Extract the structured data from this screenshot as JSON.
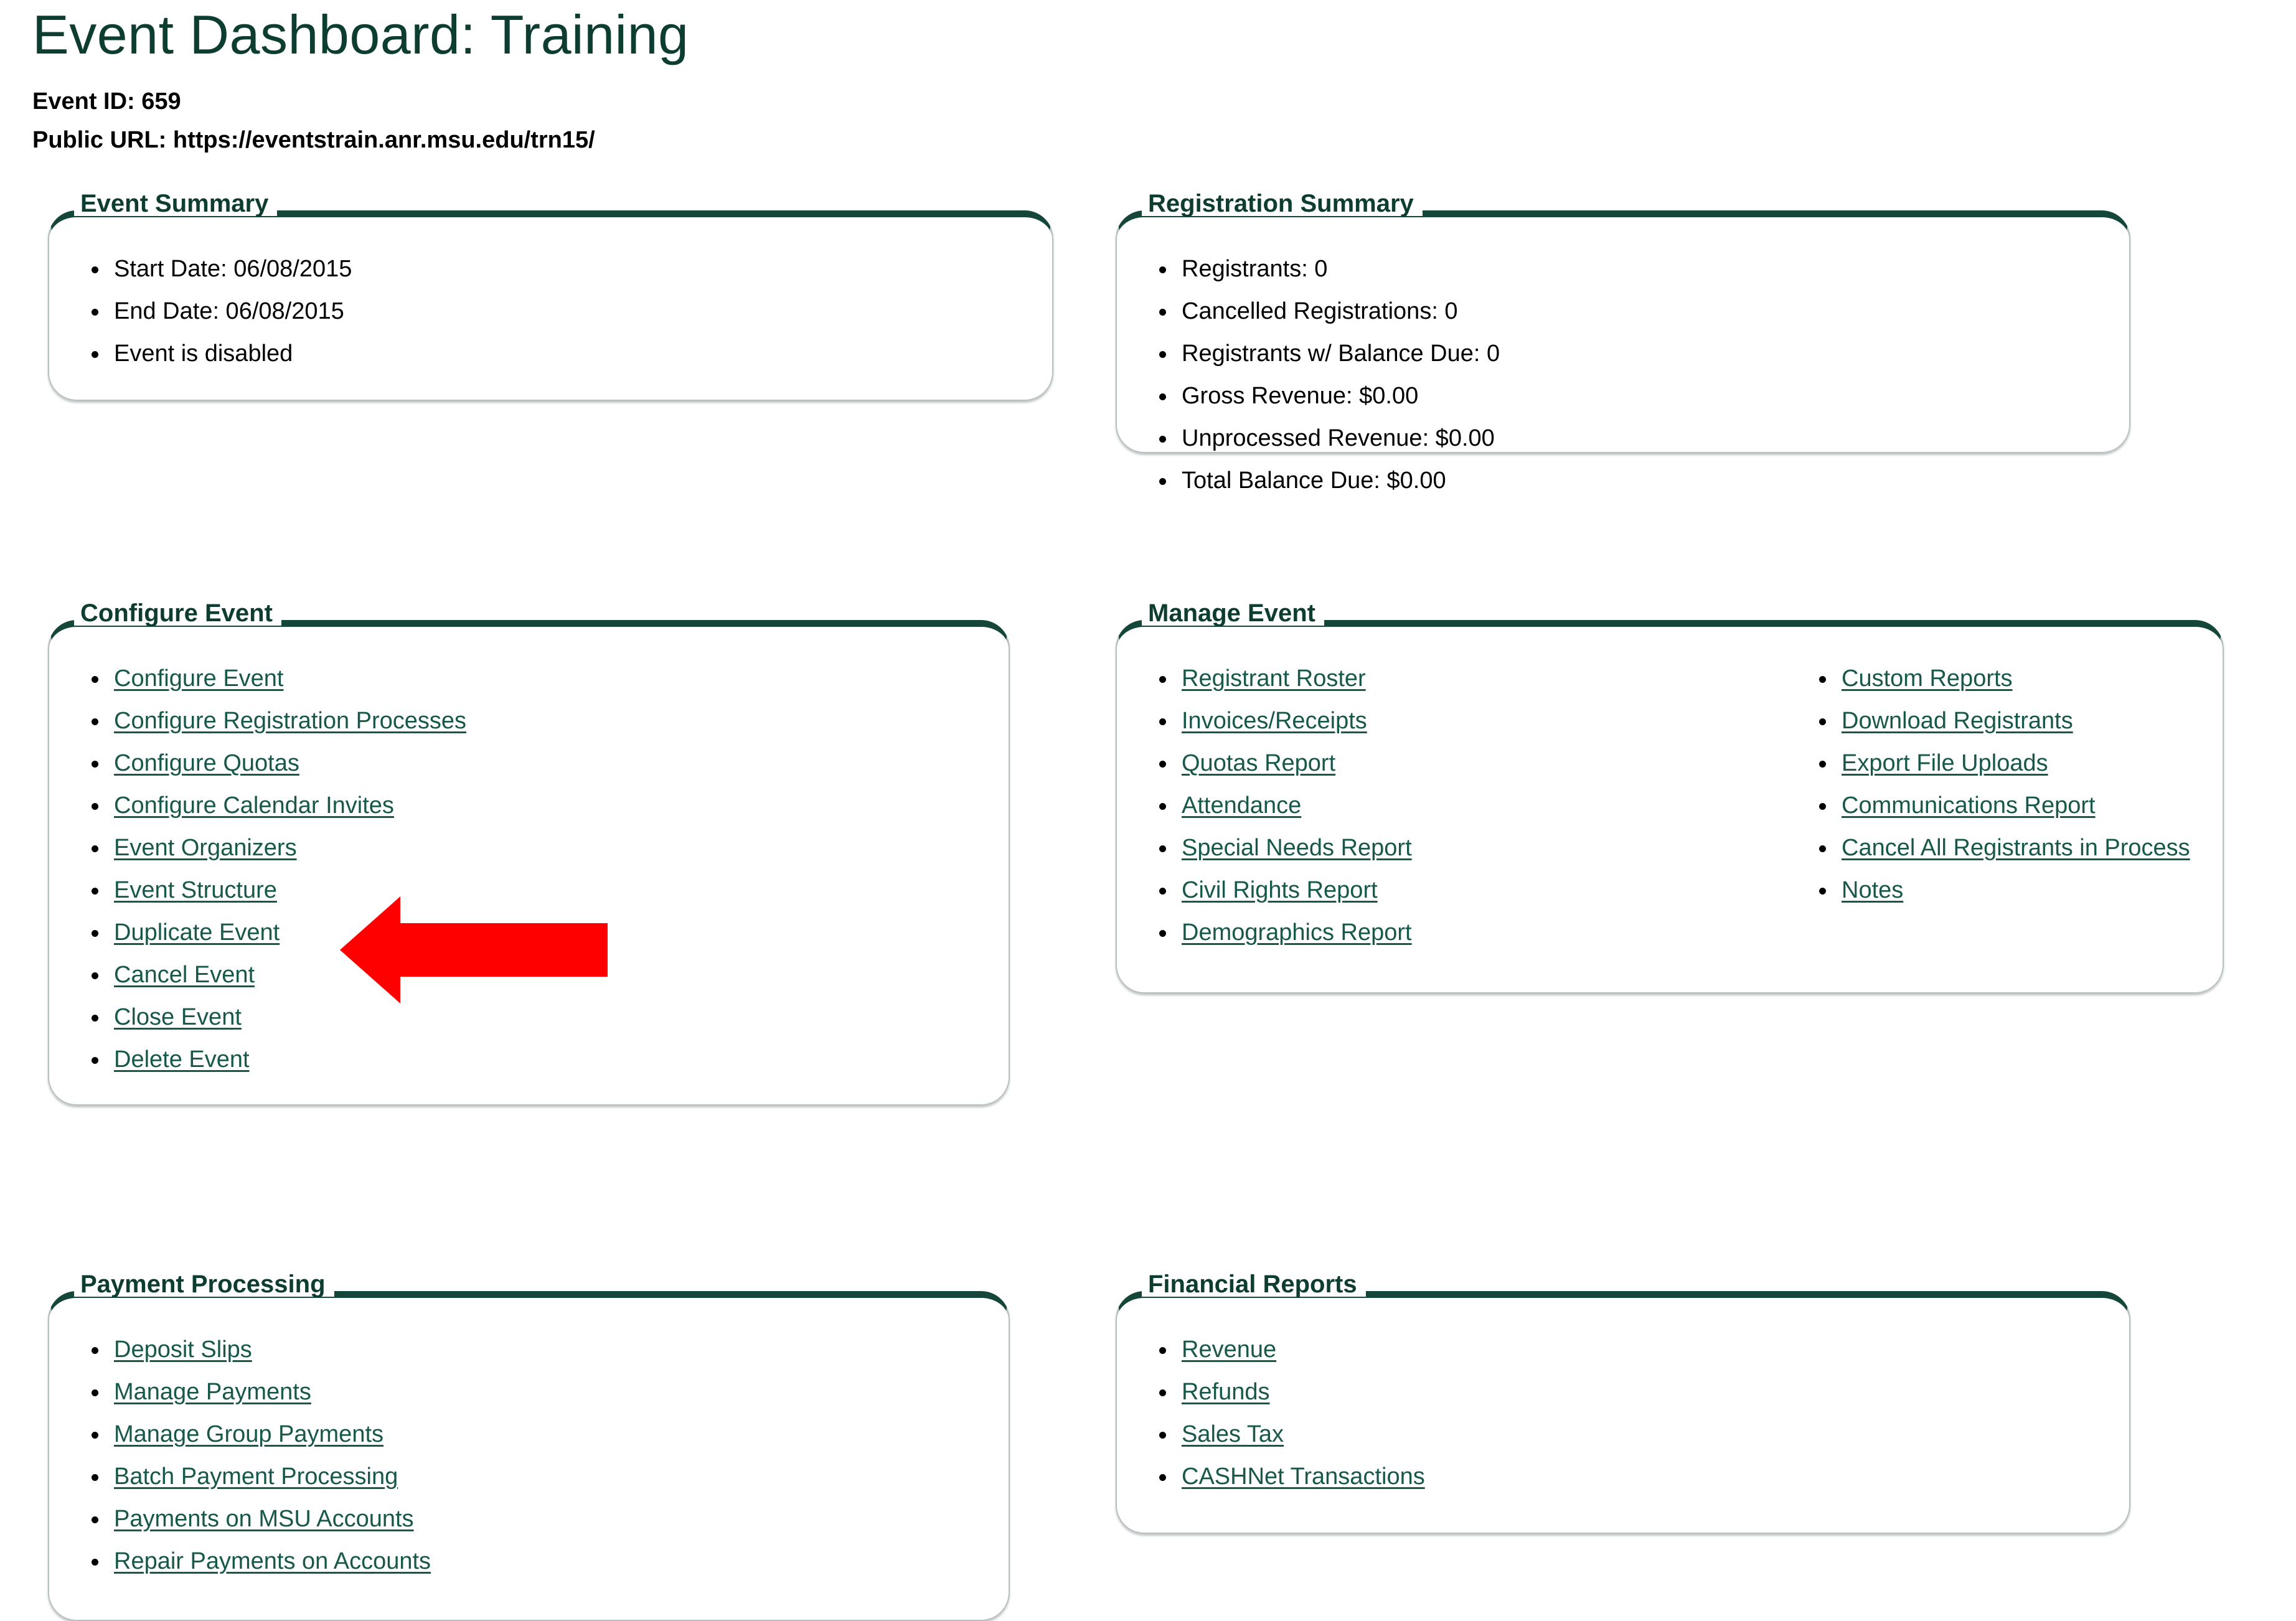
{
  "header": {
    "title": "Event Dashboard: Training",
    "event_id_line": "Event ID: 659",
    "public_url_line": "Public URL: https://eventstrain.anr.msu.edu/trn15/"
  },
  "colors": {
    "brand_green": "#0d3d31",
    "panel_border_green": "#14463a",
    "link_green": "#17584a",
    "annotation_red": "#ff0000",
    "panel_side_border": "#b7bfc0",
    "background": "#ffffff",
    "text": "#000000"
  },
  "annotation": {
    "shape": "left-arrow",
    "color": "#ff0000",
    "points_at": "Duplicate Event"
  },
  "panels": {
    "event_summary": {
      "legend": "Event Summary",
      "items": [
        "Start Date: 06/08/2015",
        "End Date: 06/08/2015",
        "Event is disabled"
      ]
    },
    "registration_summary": {
      "legend": "Registration Summary",
      "items": [
        "Registrants: 0",
        "Cancelled Registrations: 0",
        "Registrants w/ Balance Due: 0",
        "Gross Revenue: $0.00",
        "Unprocessed Revenue: $0.00",
        "Total Balance Due: $0.00"
      ]
    },
    "configure_event": {
      "legend": "Configure Event",
      "links": [
        "Configure Event",
        "Configure Registration Processes",
        "Configure Quotas",
        "Configure Calendar Invites",
        "Event Organizers",
        "Event Structure",
        "Duplicate Event",
        "Cancel Event",
        "Close Event",
        "Delete Event"
      ]
    },
    "manage_event": {
      "legend": "Manage Event",
      "links_col1": [
        "Registrant Roster",
        "Invoices/Receipts",
        "Quotas Report",
        "Attendance",
        "Special Needs Report",
        "Civil Rights Report",
        "Demographics Report"
      ],
      "links_col2": [
        "Custom Reports",
        "Download Registrants",
        "Export File Uploads",
        "Communications Report",
        "Cancel All Registrants in Process",
        "Notes"
      ]
    },
    "payment_processing": {
      "legend": "Payment Processing",
      "links": [
        "Deposit Slips",
        "Manage Payments",
        "Manage Group Payments",
        "Batch Payment Processing",
        "Payments on MSU Accounts",
        "Repair Payments on Accounts"
      ]
    },
    "financial_reports": {
      "legend": "Financial Reports",
      "links": [
        "Revenue",
        "Refunds",
        "Sales Tax",
        "CASHNet Transactions"
      ]
    }
  }
}
